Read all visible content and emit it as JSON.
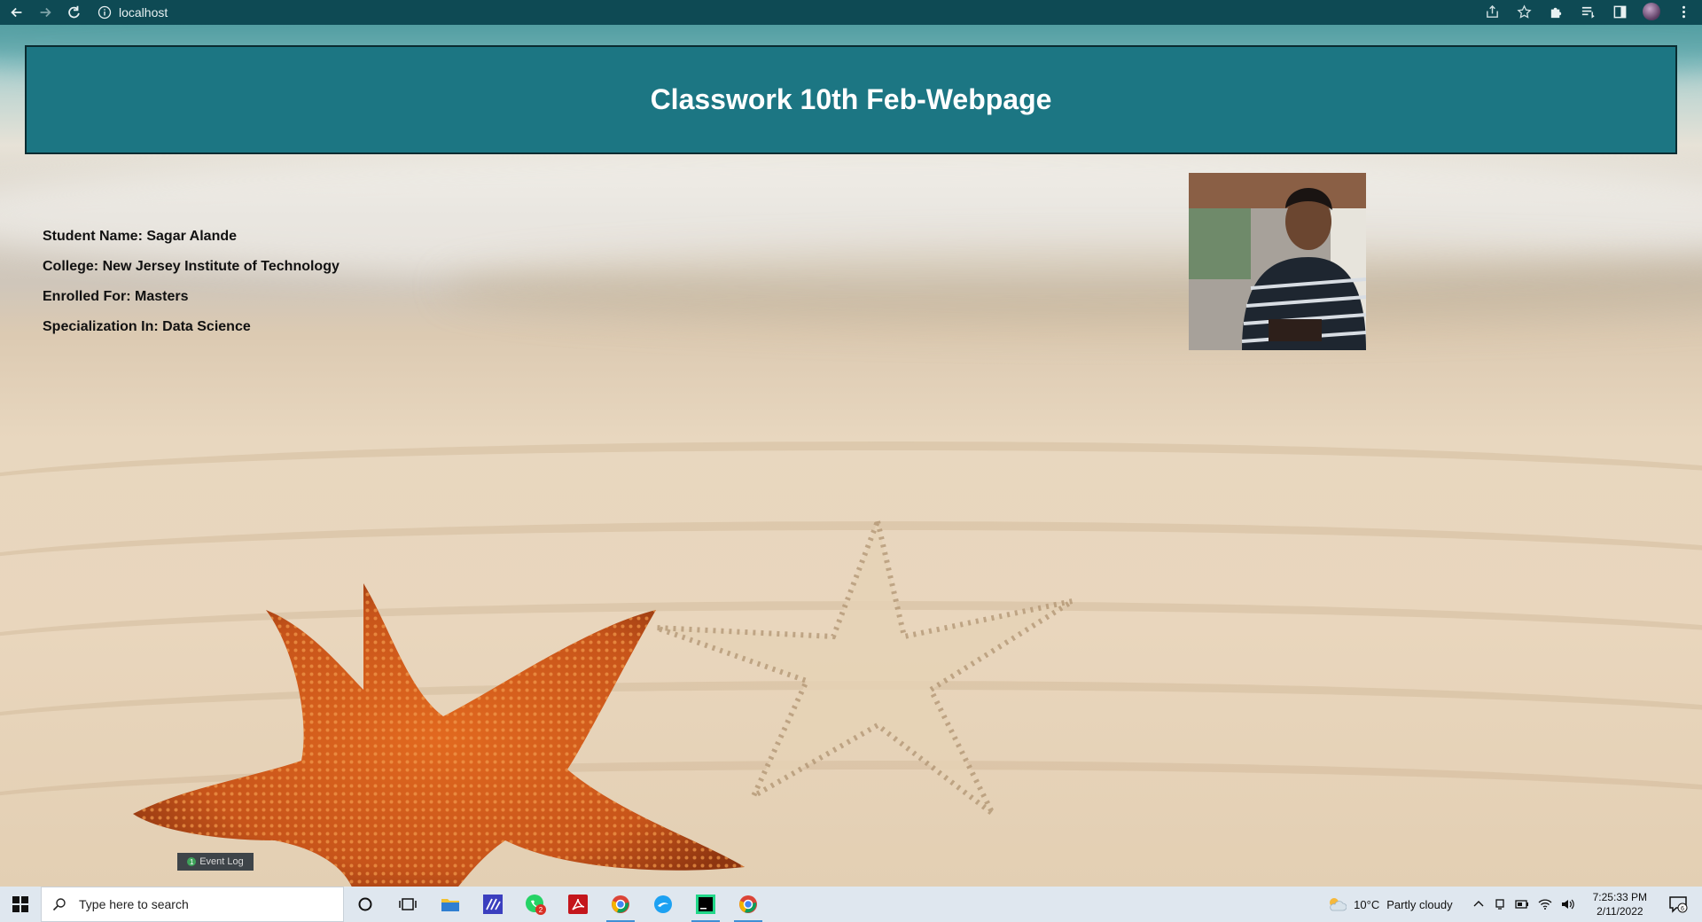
{
  "browser": {
    "url": "localhost"
  },
  "page": {
    "title": "Classwork 10th Feb-Webpage",
    "info": [
      "Student Name: Sagar Alande",
      "College: New Jersey Institute of Technology",
      "Enrolled For: Masters",
      "Specialization In: Data Science"
    ]
  },
  "event_log": {
    "count": "1",
    "label": "Event Log"
  },
  "taskbar": {
    "search_placeholder": "Type here to search",
    "whatsapp_badge": "2",
    "weather": "10°C",
    "weather_text": "Partly cloudy",
    "time": "7:25:33 PM",
    "date": "2/11/2022",
    "notification_count": "6"
  },
  "colors": {
    "browser_bar": "#0e4a54",
    "header_bg": "#1c7683",
    "header_text": "#ffffff",
    "taskbar": "#dfe7ef"
  }
}
